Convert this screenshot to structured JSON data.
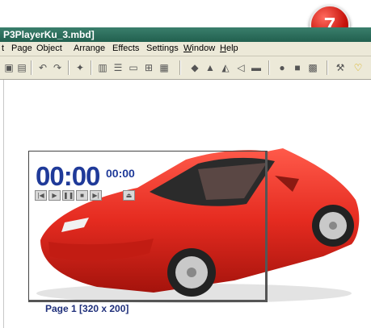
{
  "window": {
    "title": "P3PlayerKu_3.mbd]"
  },
  "menu": [
    {
      "label": "t"
    },
    {
      "label": "Page"
    },
    {
      "label": "Object"
    },
    {
      "label": "Arrange"
    },
    {
      "label": "Effects"
    },
    {
      "label": "Settings"
    },
    {
      "label": "Window"
    },
    {
      "label": "Help"
    }
  ],
  "toolbar": {
    "icons": [
      "disk-icon",
      "print-icon",
      "undo-icon",
      "redo-icon",
      "wand-tool-icon",
      "text-column-icon",
      "text-lines-icon",
      "folder-icon",
      "grid-icon",
      "frame-icon",
      "drop-icon",
      "triangle-icon",
      "mirror-icon",
      "pointer-icon",
      "layout-icon",
      "circle-icon",
      "square-icon",
      "box-icon",
      "magic-icon",
      "lasso-icon"
    ]
  },
  "badge": {
    "number": "7",
    "color": "#c8140c"
  },
  "player": {
    "time_main": "00:00",
    "time_sub": "00:00",
    "controls": [
      "rewind-start",
      "play",
      "pause",
      "stop",
      "forward-end",
      "eject"
    ]
  },
  "page_label": "Page 1 [320 x 200]",
  "colors": {
    "accent": "#1f3a99",
    "titlebar": "#22604f",
    "car": "#e52b20"
  }
}
